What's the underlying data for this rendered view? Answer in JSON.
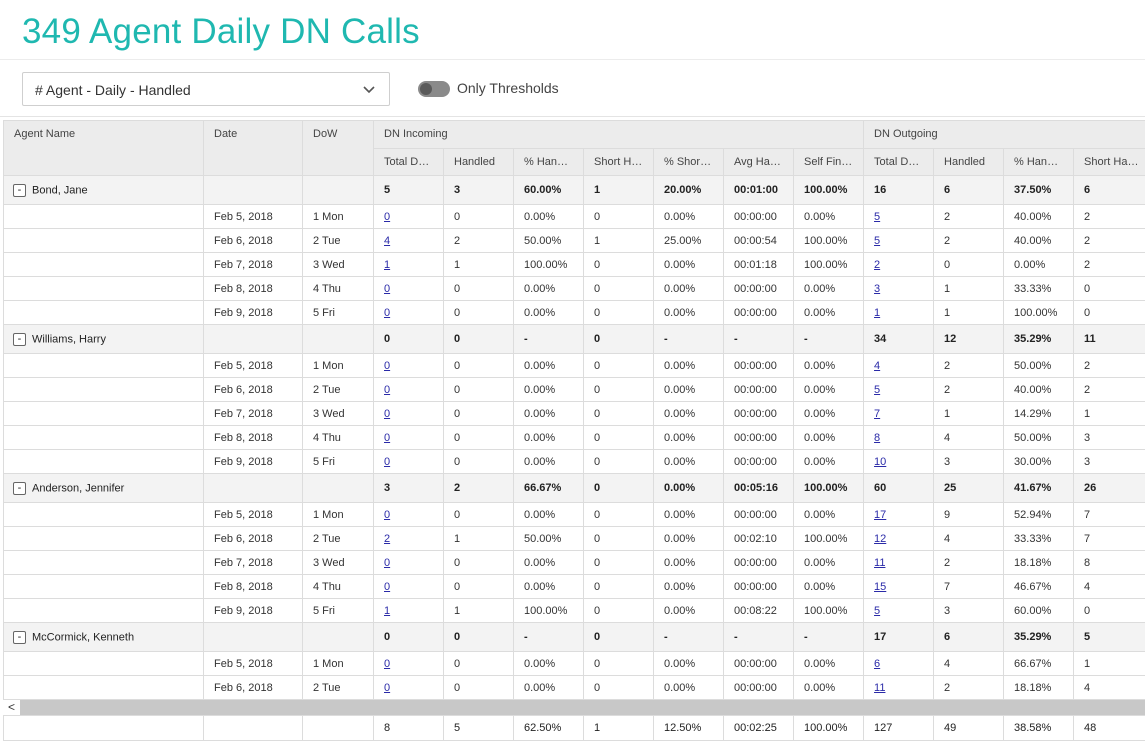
{
  "title": "349 Agent Daily DN Calls",
  "report_select": {
    "value": "# Agent - Daily - Handled"
  },
  "toggle": {
    "label": "Only Thresholds"
  },
  "headers": {
    "agent_name": "Agent Name",
    "date": "Date",
    "dow": "DoW",
    "group_incoming": "DN Incoming",
    "group_outgoing": "DN Outgoing",
    "in": [
      "Total DN Incoming",
      "Handled",
      "% Handled",
      "Short Handled",
      "% Short Handled",
      "Avg Handle Time",
      "Self Finished"
    ],
    "out": [
      "Total DN Outgoing",
      "Handled",
      "% Handled",
      "Short Handled"
    ]
  },
  "groups": [
    {
      "agent": "Bond, Jane",
      "expander": "-",
      "summary": [
        "5",
        "3",
        "60.00%",
        "1",
        "20.00%",
        "00:01:00",
        "100.00%",
        "16",
        "6",
        "37.50%",
        "6"
      ],
      "rows": [
        {
          "date": "Feb 5, 2018",
          "dow": "1 Mon",
          "values": [
            "0",
            "0",
            "0.00%",
            "0",
            "0.00%",
            "00:00:00",
            "0.00%",
            "5",
            "2",
            "40.00%",
            "2"
          ]
        },
        {
          "date": "Feb 6, 2018",
          "dow": "2 Tue",
          "values": [
            "4",
            "2",
            "50.00%",
            "1",
            "25.00%",
            "00:00:54",
            "100.00%",
            "5",
            "2",
            "40.00%",
            "2"
          ]
        },
        {
          "date": "Feb 7, 2018",
          "dow": "3 Wed",
          "values": [
            "1",
            "1",
            "100.00%",
            "0",
            "0.00%",
            "00:01:18",
            "100.00%",
            "2",
            "0",
            "0.00%",
            "2"
          ]
        },
        {
          "date": "Feb 8, 2018",
          "dow": "4 Thu",
          "values": [
            "0",
            "0",
            "0.00%",
            "0",
            "0.00%",
            "00:00:00",
            "0.00%",
            "3",
            "1",
            "33.33%",
            "0"
          ]
        },
        {
          "date": "Feb 9, 2018",
          "dow": "5 Fri",
          "values": [
            "0",
            "0",
            "0.00%",
            "0",
            "0.00%",
            "00:00:00",
            "0.00%",
            "1",
            "1",
            "100.00%",
            "0"
          ]
        }
      ]
    },
    {
      "agent": "Williams, Harry",
      "expander": "-",
      "summary": [
        "0",
        "0",
        "-",
        "0",
        "-",
        "-",
        "-",
        "34",
        "12",
        "35.29%",
        "11"
      ],
      "rows": [
        {
          "date": "Feb 5, 2018",
          "dow": "1 Mon",
          "values": [
            "0",
            "0",
            "0.00%",
            "0",
            "0.00%",
            "00:00:00",
            "0.00%",
            "4",
            "2",
            "50.00%",
            "2"
          ]
        },
        {
          "date": "Feb 6, 2018",
          "dow": "2 Tue",
          "values": [
            "0",
            "0",
            "0.00%",
            "0",
            "0.00%",
            "00:00:00",
            "0.00%",
            "5",
            "2",
            "40.00%",
            "2"
          ]
        },
        {
          "date": "Feb 7, 2018",
          "dow": "3 Wed",
          "values": [
            "0",
            "0",
            "0.00%",
            "0",
            "0.00%",
            "00:00:00",
            "0.00%",
            "7",
            "1",
            "14.29%",
            "1"
          ]
        },
        {
          "date": "Feb 8, 2018",
          "dow": "4 Thu",
          "values": [
            "0",
            "0",
            "0.00%",
            "0",
            "0.00%",
            "00:00:00",
            "0.00%",
            "8",
            "4",
            "50.00%",
            "3"
          ]
        },
        {
          "date": "Feb 9, 2018",
          "dow": "5 Fri",
          "values": [
            "0",
            "0",
            "0.00%",
            "0",
            "0.00%",
            "00:00:00",
            "0.00%",
            "10",
            "3",
            "30.00%",
            "3"
          ]
        }
      ]
    },
    {
      "agent": "Anderson, Jennifer",
      "expander": "-",
      "summary": [
        "3",
        "2",
        "66.67%",
        "0",
        "0.00%",
        "00:05:16",
        "100.00%",
        "60",
        "25",
        "41.67%",
        "26"
      ],
      "rows": [
        {
          "date": "Feb 5, 2018",
          "dow": "1 Mon",
          "values": [
            "0",
            "0",
            "0.00%",
            "0",
            "0.00%",
            "00:00:00",
            "0.00%",
            "17",
            "9",
            "52.94%",
            "7"
          ]
        },
        {
          "date": "Feb 6, 2018",
          "dow": "2 Tue",
          "values": [
            "2",
            "1",
            "50.00%",
            "0",
            "0.00%",
            "00:02:10",
            "100.00%",
            "12",
            "4",
            "33.33%",
            "7"
          ]
        },
        {
          "date": "Feb 7, 2018",
          "dow": "3 Wed",
          "values": [
            "0",
            "0",
            "0.00%",
            "0",
            "0.00%",
            "00:00:00",
            "0.00%",
            "11",
            "2",
            "18.18%",
            "8"
          ]
        },
        {
          "date": "Feb 8, 2018",
          "dow": "4 Thu",
          "values": [
            "0",
            "0",
            "0.00%",
            "0",
            "0.00%",
            "00:00:00",
            "0.00%",
            "15",
            "7",
            "46.67%",
            "4"
          ]
        },
        {
          "date": "Feb 9, 2018",
          "dow": "5 Fri",
          "values": [
            "1",
            "1",
            "100.00%",
            "0",
            "0.00%",
            "00:08:22",
            "100.00%",
            "5",
            "3",
            "60.00%",
            "0"
          ]
        }
      ]
    },
    {
      "agent": "McCormick, Kenneth",
      "expander": "-",
      "summary": [
        "0",
        "0",
        "-",
        "0",
        "-",
        "-",
        "-",
        "17",
        "6",
        "35.29%",
        "5"
      ],
      "rows": [
        {
          "date": "Feb 5, 2018",
          "dow": "1 Mon",
          "values": [
            "0",
            "0",
            "0.00%",
            "0",
            "0.00%",
            "00:00:00",
            "0.00%",
            "6",
            "4",
            "66.67%",
            "1"
          ]
        },
        {
          "date": "Feb 6, 2018",
          "dow": "2 Tue",
          "values": [
            "0",
            "0",
            "0.00%",
            "0",
            "0.00%",
            "00:00:00",
            "0.00%",
            "11",
            "2",
            "18.18%",
            "4"
          ]
        }
      ]
    }
  ],
  "totals": [
    "8",
    "5",
    "62.50%",
    "1",
    "12.50%",
    "00:02:25",
    "100.00%",
    "127",
    "49",
    "38.58%",
    "48"
  ],
  "scrollbar": {
    "left_arrow": "<"
  }
}
